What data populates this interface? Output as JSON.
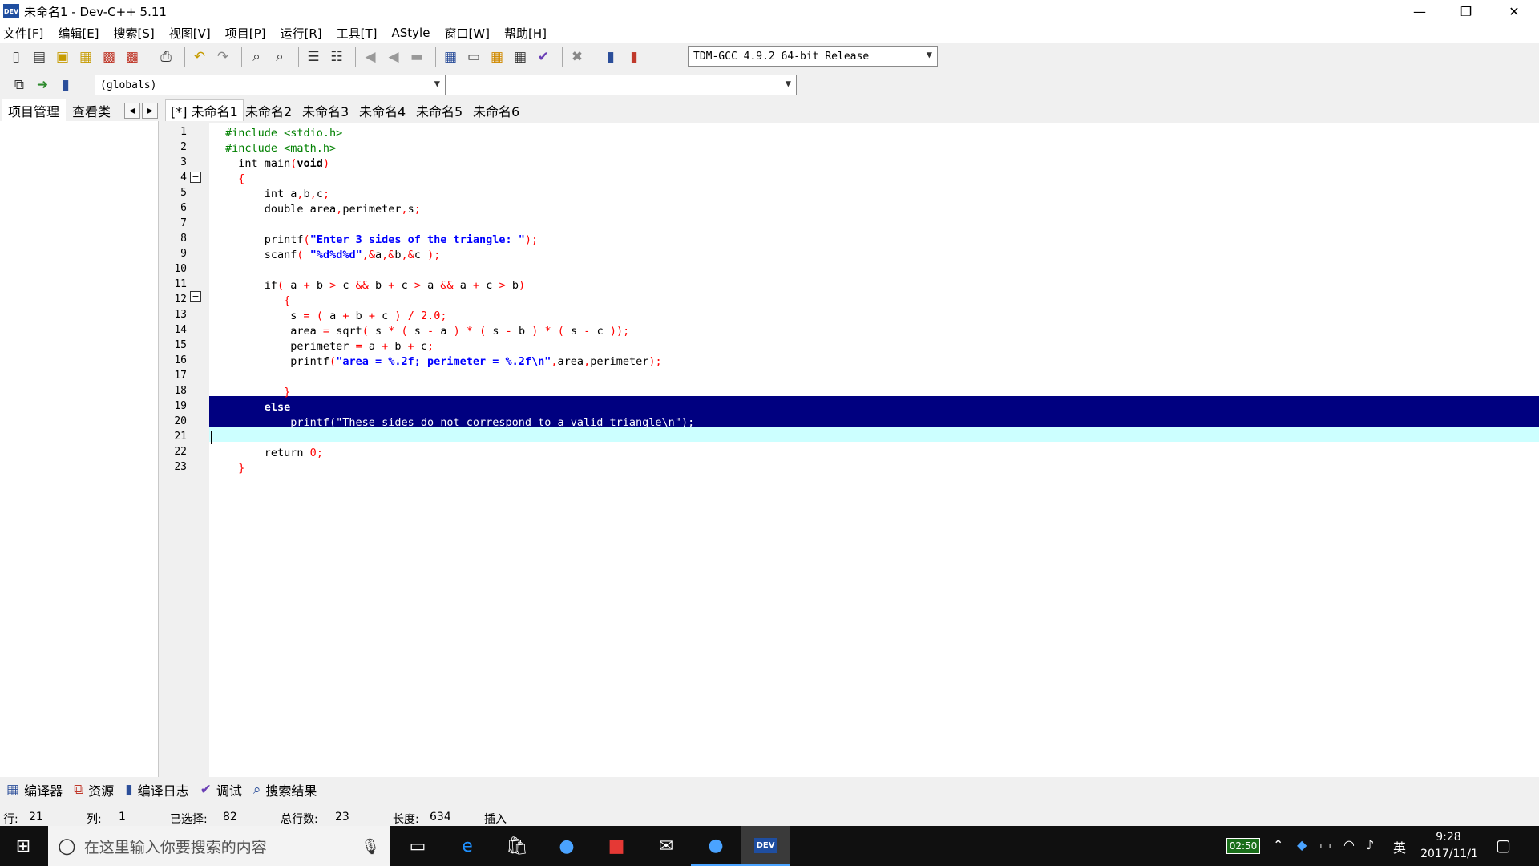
{
  "window": {
    "title": "未命名1 - Dev-C++ 5.11",
    "app_icon_text": "DEV",
    "controls": {
      "minimize": "—",
      "restore": "❐",
      "close": "✕"
    }
  },
  "menu": [
    "文件[F]",
    "编辑[E]",
    "搜索[S]",
    "视图[V]",
    "项目[P]",
    "运行[R]",
    "工具[T]",
    "AStyle",
    "窗口[W]",
    "帮助[H]"
  ],
  "toolbar": {
    "compiler_select": "TDM-GCC 4.9.2 64-bit Release",
    "scope_select": "(globals)",
    "member_select": ""
  },
  "left_tabs": [
    "项目管理",
    "查看类"
  ],
  "left_nav": {
    "prev": "◀",
    "next": "▶"
  },
  "editor_tabs": [
    "[*] 未命名1",
    "未命名2",
    "未命名3",
    "未命名4",
    "未命名5",
    "未命名6"
  ],
  "code_lines": [
    "#include <stdio.h>",
    "#include <math.h>",
    "  int main(void)",
    "  {",
    "      int a,b,c;",
    "      double area,perimeter,s;",
    "",
    "      printf(\"Enter 3 sides of the triangle: \");",
    "      scanf( \"%d%d%d\",&a,&b,&c );",
    "",
    "      if( a + b > c && b + c > a && a + c > b)",
    "         {",
    "          s = ( a + b + c ) / 2.0;",
    "          area = sqrt( s * ( s - a ) * ( s - b ) * ( s - c ));",
    "          perimeter = a + b + c;",
    "          printf(\"area = %.2f; perimeter = %.2f\\n\",area,perimeter);",
    "",
    "         }",
    "      else",
    "          printf(\"These sides do not correspond to a valid triangle\\n\");",
    "",
    "      return 0;",
    "  }"
  ],
  "bottom_tabs": [
    {
      "label": "编译器",
      "icon": "compiler-icon"
    },
    {
      "label": "资源",
      "icon": "resources-icon"
    },
    {
      "label": "编译日志",
      "icon": "compile-log-icon"
    },
    {
      "label": "调试",
      "icon": "debug-icon"
    },
    {
      "label": "搜索结果",
      "icon": "search-results-icon"
    }
  ],
  "status": {
    "row_label": "行:",
    "row": "21",
    "col_label": "列:",
    "col": "1",
    "selected_label": "已选择:",
    "selected": "82",
    "total_label": "总行数:",
    "total": "23",
    "length_label": "长度:",
    "length": "634",
    "mode": "插入"
  },
  "taskbar": {
    "search_placeholder": "在这里输入你要搜索的内容",
    "battery_time": "02:50",
    "ime": "英",
    "time": "9:28",
    "date": "2017/11/1"
  },
  "colors": {
    "selection": "#000080",
    "current_line": "#ccffff",
    "keyword": "#000000",
    "string": "#0000ff",
    "symbol": "#ff0000",
    "preprocessor": "#008000"
  }
}
